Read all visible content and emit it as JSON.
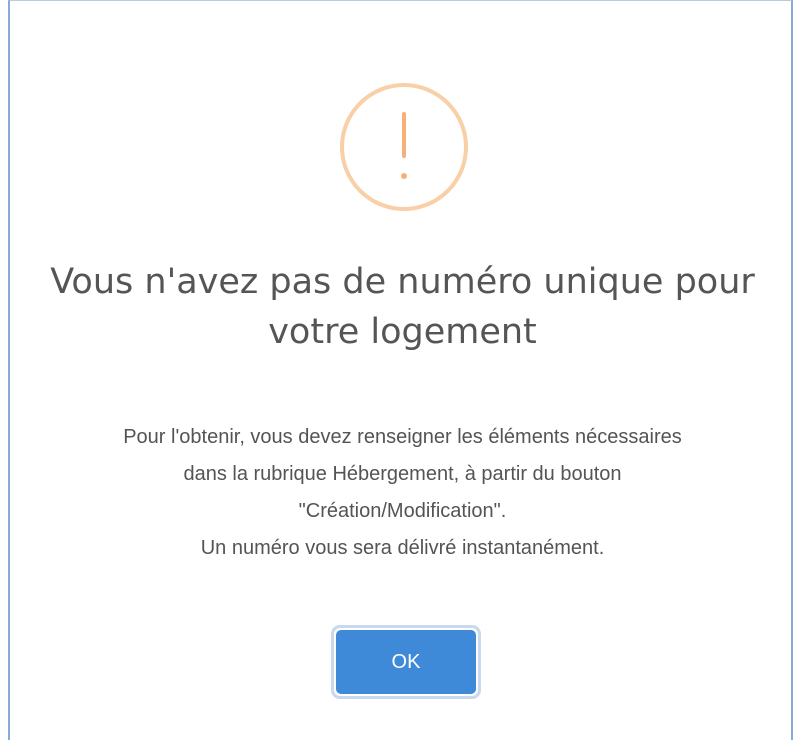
{
  "dialog": {
    "icon": "warning-exclamation-icon",
    "title": "Vous n'avez pas de numéro unique pour votre logement",
    "message_lines": [
      "Pour l'obtenir, vous devez renseigner les éléments nécessaires",
      "dans la rubrique Hébergement, à partir du bouton",
      "\"Création/Modification\".",
      "Un numéro vous sera délivré instantanément."
    ],
    "ok_label": "OK"
  },
  "colors": {
    "icon_ring": "#f8cfa6",
    "icon_mark": "#f7b07a",
    "button": "#3f8ad8",
    "border": "#8aaad6"
  }
}
